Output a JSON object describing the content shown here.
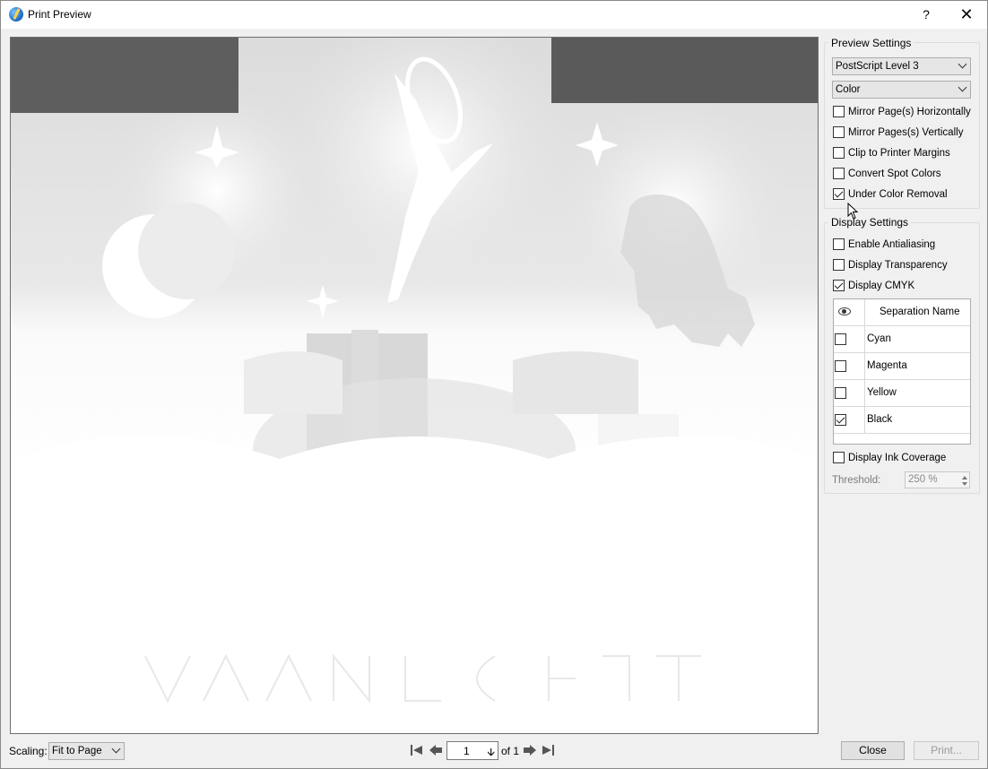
{
  "window": {
    "title": "Print Preview",
    "help": "?",
    "close": "✕"
  },
  "preview_settings": {
    "title": "Preview Settings",
    "level": "PostScript Level 3",
    "color": "Color",
    "options": [
      {
        "label": "Mirror Page(s) Horizontally",
        "checked": false
      },
      {
        "label": "Mirror Pages(s) Vertically",
        "checked": false
      },
      {
        "label": "Clip to Printer Margins",
        "checked": false
      },
      {
        "label": "Convert Spot Colors",
        "checked": false
      },
      {
        "label": "Under Color Removal",
        "checked": true
      }
    ]
  },
  "display_settings": {
    "title": "Display Settings",
    "options": [
      {
        "label": "Enable Antialiasing",
        "checked": false
      },
      {
        "label": "Display Transparency",
        "checked": false
      },
      {
        "label": "Display CMYK",
        "checked": true
      }
    ],
    "separations": {
      "header": "Separation Name",
      "rows": [
        {
          "name": "Cyan",
          "checked": false
        },
        {
          "name": "Magenta",
          "checked": false
        },
        {
          "name": "Yellow",
          "checked": false
        },
        {
          "name": "Black",
          "checked": true
        }
      ]
    },
    "ink_coverage": {
      "label": "Display Ink Coverage",
      "checked": false
    },
    "threshold": {
      "label": "Threshold:",
      "value": "250 %"
    }
  },
  "footer": {
    "scaling_label": "Scaling:",
    "scaling_value": "Fit to Page",
    "page": "1",
    "of_label": "of 1",
    "close_button": "Close",
    "print_button": "Print..."
  },
  "colors": {
    "preview_bg": "#ffffff",
    "dark_band": "#5a5a5a",
    "dialog_bg": "#f0f0f0"
  },
  "icons": {
    "first": "first-page-icon",
    "prev": "prev-page-icon",
    "next": "next-page-icon",
    "last": "last-page-icon",
    "eye": "eye-icon"
  }
}
